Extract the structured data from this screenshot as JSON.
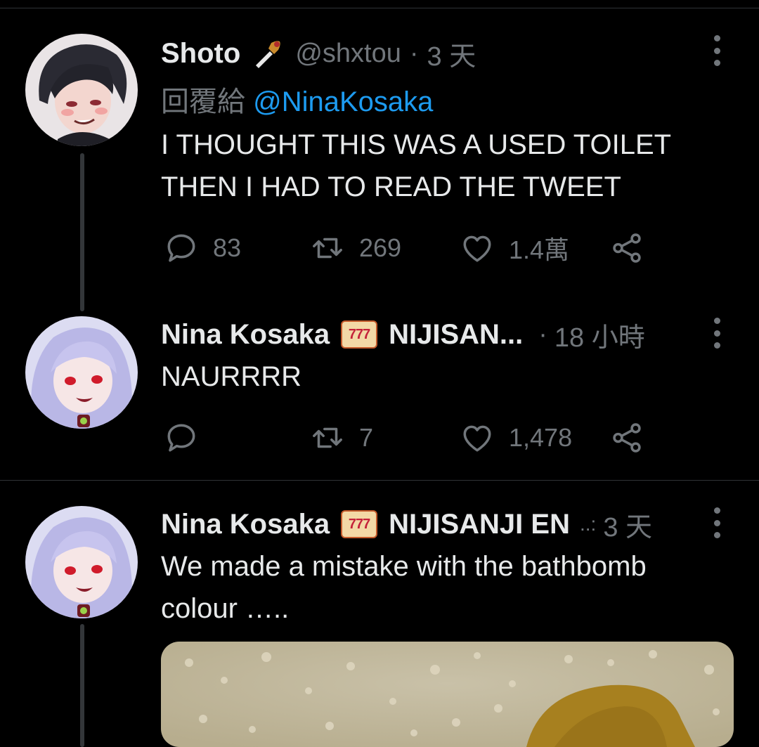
{
  "tweets": [
    {
      "name": "Shoto",
      "name_emoji": "🗡️",
      "handle": "@shxtou",
      "separator": "·",
      "time": "3 天",
      "reply_prefix": "回覆給",
      "reply_mention": "@NinaKosaka",
      "lines": [
        "I THOUGHT THIS WAS A USED TOILET",
        "THEN I HAD TO READ THE TWEET"
      ],
      "replies": "83",
      "retweets": "269",
      "likes": "1.4萬"
    },
    {
      "name": "Nina Kosaka",
      "badge": "777",
      "suffix": "NIJISAN...",
      "separator": "·",
      "time": "18 小時",
      "lines": [
        "NAURRRR"
      ],
      "replies": "",
      "retweets": "7",
      "likes": "1,478"
    },
    {
      "name": "Nina Kosaka",
      "badge": "777",
      "suffix": "NIJISANJI EN",
      "truncation": "..:",
      "time": "3 天",
      "lines": [
        "We made a mistake with the bathbomb",
        "colour ….."
      ]
    }
  ],
  "icons": {
    "reply": "speech-bubble-icon",
    "retweet": "retweet-icon",
    "like": "heart-icon",
    "share": "share-icon",
    "more": "more-vertical-icon"
  },
  "colors": {
    "background": "#000000",
    "text": "#e7e9ea",
    "secondary": "#71767b",
    "mention": "#1d9bf0",
    "divider": "#2f3336"
  }
}
